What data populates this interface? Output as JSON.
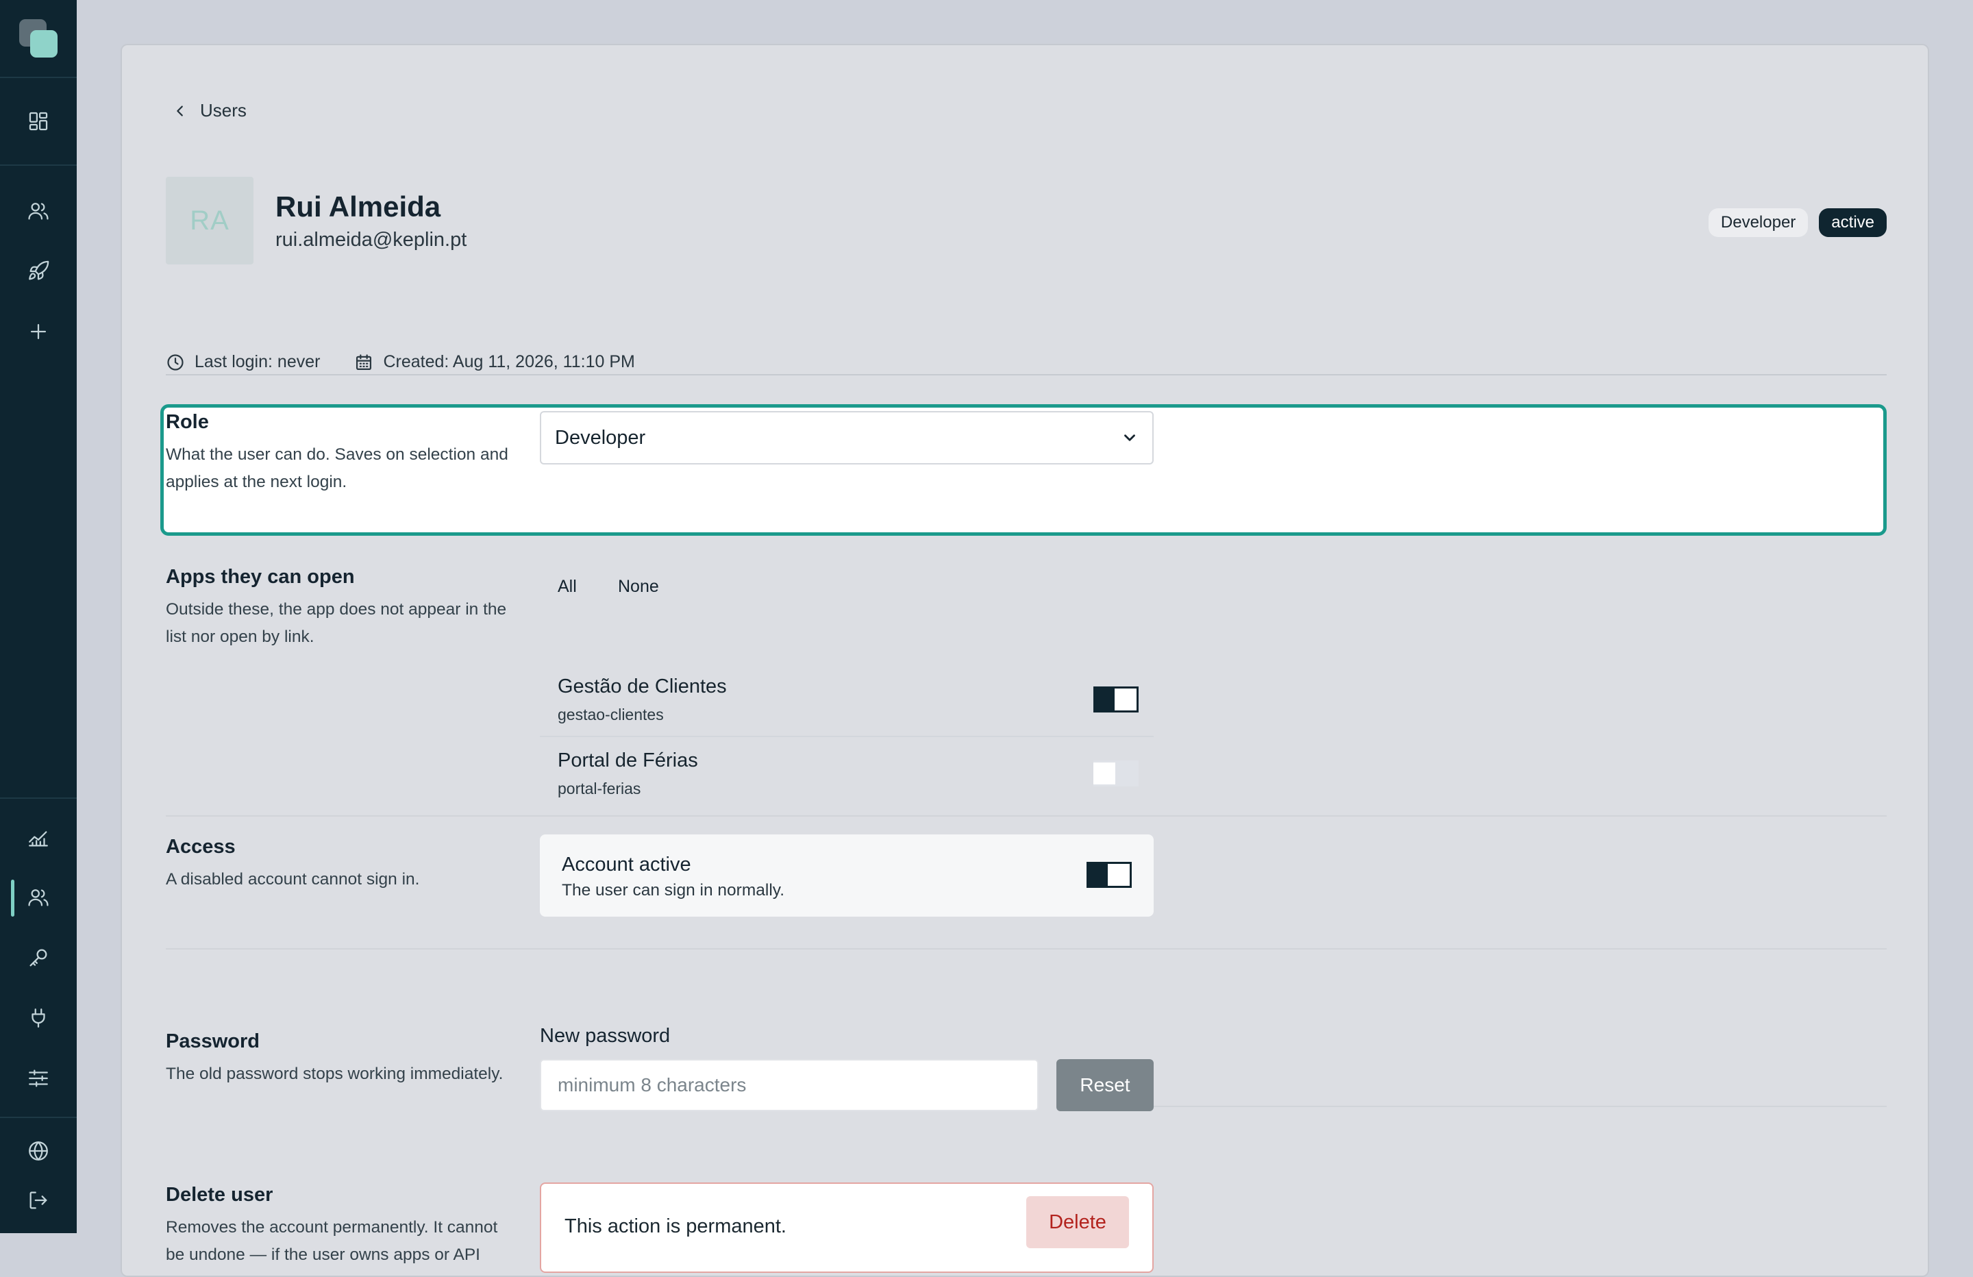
{
  "sidebar": {
    "top_icons": [
      "dashboard-icon",
      "users-icon",
      "rocket-icon",
      "plus-icon"
    ],
    "bottom_icons": [
      "analytics-icon",
      "users-icon",
      "key-icon",
      "plug-icon",
      "sliders-icon",
      "globe-icon",
      "logout-icon"
    ],
    "active_item": "users"
  },
  "header": {
    "back_label": "Users",
    "avatar_initials": "RA",
    "name": "Rui Almeida",
    "email": "rui.almeida@keplin.pt",
    "role_badge": "Developer",
    "status_badge": "active",
    "last_login": "Last login: never",
    "created": "Created: Aug 11, 2026, 11:10 PM"
  },
  "role": {
    "title": "Role",
    "description": "What the user can do. Saves on selection and applies at the next login.",
    "selected": "Developer"
  },
  "apps": {
    "title": "Apps they can open",
    "description": "Outside these, the app does not appear in the list nor open by link.",
    "all_label": "All",
    "none_label": "None",
    "items": [
      {
        "name": "Gestão de Clientes",
        "slug": "gestao-clientes",
        "enabled": true
      },
      {
        "name": "Portal de Férias",
        "slug": "portal-ferias",
        "enabled": false
      }
    ]
  },
  "access": {
    "title": "Access",
    "description": "A disabled account cannot sign in.",
    "toggle_title": "Account active",
    "toggle_sub": "The user can sign in normally.",
    "enabled": true
  },
  "password": {
    "title": "Password",
    "description": "The old password stops working immediately.",
    "field_label": "New password",
    "placeholder": "minimum 8 characters",
    "button": "Reset"
  },
  "delete": {
    "title": "Delete user",
    "description": "Removes the account permanently. It cannot be undone — if the user owns apps or API",
    "warning": "This action is permanent.",
    "button": "Delete"
  },
  "colors": {
    "sidebar_bg": "#0e2530",
    "accent": "#1b9a8c",
    "danger": "#b3231e"
  }
}
